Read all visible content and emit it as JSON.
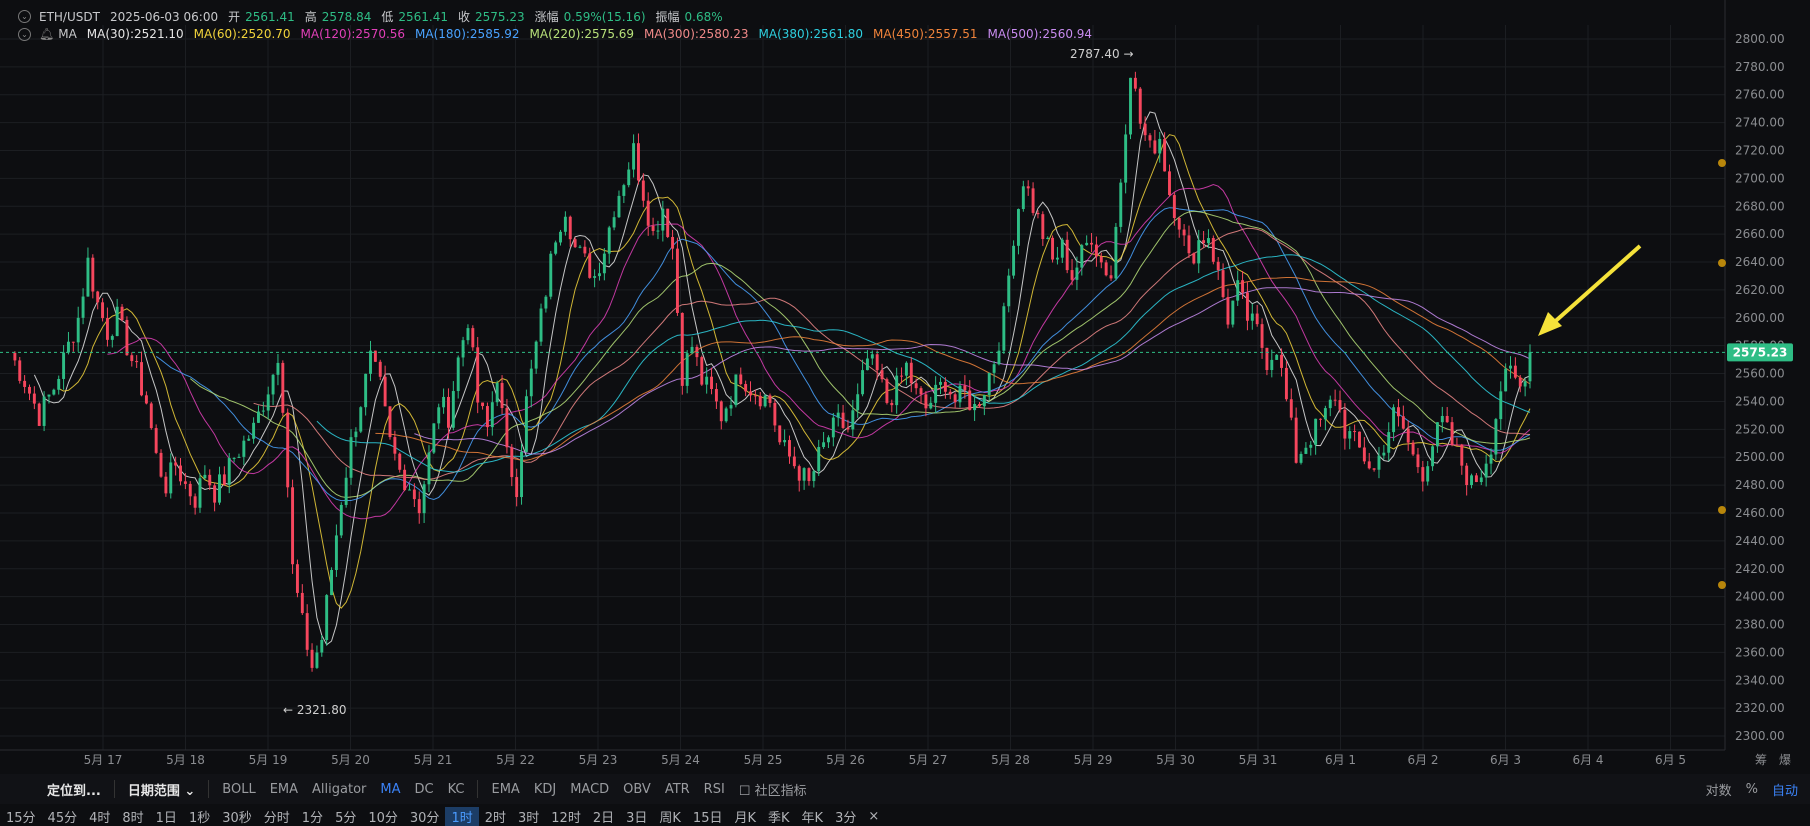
{
  "header": {
    "symbol": "ETH/USDT",
    "datetime": "2025-06-03 06:00",
    "open_label": "开",
    "open": "2561.41",
    "high_label": "高",
    "high": "2578.84",
    "low_label": "低",
    "low": "2561.41",
    "close_label": "收",
    "close": "2575.23",
    "change_label": "涨幅",
    "change": "0.59%(15.16)",
    "amp_label": "振幅",
    "amp": "0.68%"
  },
  "ma_row": {
    "name": "MA",
    "items": [
      {
        "label": "MA(30):2521.10",
        "color": "#e6e6e6"
      },
      {
        "label": "MA(60):2520.70",
        "color": "#f2d43c"
      },
      {
        "label": "MA(120):2570.56",
        "color": "#e040b8"
      },
      {
        "label": "MA(180):2585.92",
        "color": "#4aa3ff"
      },
      {
        "label": "MA(220):2575.69",
        "color": "#b7e07a"
      },
      {
        "label": "MA(300):2580.23",
        "color": "#f08a8a"
      },
      {
        "label": "MA(380):2561.80",
        "color": "#2fd0e0"
      },
      {
        "label": "MA(450):2557.51",
        "color": "#f0843c"
      },
      {
        "label": "MA(500):2560.94",
        "color": "#c88cf0"
      }
    ]
  },
  "chart_data": {
    "type": "candlestick",
    "ylim": [
      2290,
      2810
    ],
    "y_ticks": [
      "2800.00",
      "2780.00",
      "2760.00",
      "2740.00",
      "2720.00",
      "2700.00",
      "2680.00",
      "2660.00",
      "2640.00",
      "2620.00",
      "2600.00",
      "2580.00",
      "2560.00",
      "2540.00",
      "2520.00",
      "2500.00",
      "2480.00",
      "2460.00",
      "2440.00",
      "2420.00",
      "2400.00",
      "2380.00",
      "2360.00",
      "2340.00",
      "2320.00",
      "2300.00"
    ],
    "x_ticks": [
      "5月 17",
      "5月 18",
      "5月 19",
      "5月 20",
      "5月 21",
      "5月 22",
      "5月 23",
      "5月 24",
      "5月 25",
      "5月 26",
      "5月 27",
      "5月 28",
      "5月 29",
      "5月 30",
      "5月 31",
      "6月 1",
      "6月 2",
      "6月 3",
      "6月 4",
      "6月 5"
    ],
    "x_ticks_extra": [
      "筹",
      "爆"
    ],
    "last_price": "2575.23",
    "high_marker": "2787.40 →",
    "low_marker": "← 2321.80",
    "up_color": "#2ebd85",
    "down_color": "#f6465d",
    "close_path": [
      [
        0,
        2575
      ],
      [
        3,
        2555
      ],
      [
        6,
        2530
      ],
      [
        9,
        2550
      ],
      [
        12,
        2580
      ],
      [
        14,
        2600
      ],
      [
        16,
        2640
      ],
      [
        18,
        2610
      ],
      [
        20,
        2590
      ],
      [
        22,
        2600
      ],
      [
        24,
        2580
      ],
      [
        26,
        2560
      ],
      [
        28,
        2540
      ],
      [
        30,
        2500
      ],
      [
        32,
        2480
      ],
      [
        34,
        2495
      ],
      [
        36,
        2480
      ],
      [
        38,
        2470
      ],
      [
        40,
        2490
      ],
      [
        42,
        2475
      ],
      [
        44,
        2485
      ],
      [
        46,
        2500
      ],
      [
        48,
        2510
      ],
      [
        50,
        2520
      ],
      [
        52,
        2540
      ],
      [
        54,
        2560
      ],
      [
        55,
        2575
      ],
      [
        56,
        2540
      ],
      [
        58,
        2420
      ],
      [
        60,
        2380
      ],
      [
        62,
        2350
      ],
      [
        64,
        2370
      ],
      [
        66,
        2420
      ],
      [
        68,
        2470
      ],
      [
        70,
        2510
      ],
      [
        72,
        2540
      ],
      [
        74,
        2570
      ],
      [
        76,
        2550
      ],
      [
        78,
        2510
      ],
      [
        80,
        2490
      ],
      [
        82,
        2480
      ],
      [
        84,
        2465
      ],
      [
        86,
        2500
      ],
      [
        88,
        2540
      ],
      [
        90,
        2530
      ],
      [
        92,
        2570
      ],
      [
        94,
        2600
      ],
      [
        96,
        2540
      ],
      [
        98,
        2520
      ],
      [
        100,
        2560
      ],
      [
        102,
        2500
      ],
      [
        104,
        2480
      ],
      [
        106,
        2540
      ],
      [
        108,
        2580
      ],
      [
        110,
        2620
      ],
      [
        112,
        2660
      ],
      [
        114,
        2680
      ],
      [
        116,
        2650
      ],
      [
        118,
        2640
      ],
      [
        120,
        2630
      ],
      [
        122,
        2650
      ],
      [
        124,
        2680
      ],
      [
        126,
        2700
      ],
      [
        128,
        2720
      ],
      [
        130,
        2690
      ],
      [
        132,
        2660
      ],
      [
        134,
        2680
      ],
      [
        136,
        2650
      ],
      [
        138,
        2560
      ],
      [
        140,
        2580
      ],
      [
        142,
        2555
      ],
      [
        144,
        2545
      ],
      [
        146,
        2530
      ],
      [
        148,
        2545
      ],
      [
        150,
        2560
      ],
      [
        152,
        2550
      ],
      [
        154,
        2545
      ],
      [
        156,
        2540
      ],
      [
        158,
        2510
      ],
      [
        160,
        2500
      ],
      [
        162,
        2490
      ],
      [
        164,
        2480
      ],
      [
        166,
        2500
      ],
      [
        168,
        2515
      ],
      [
        170,
        2525
      ],
      [
        172,
        2520
      ],
      [
        174,
        2540
      ],
      [
        176,
        2570
      ],
      [
        178,
        2560
      ],
      [
        180,
        2540
      ],
      [
        182,
        2550
      ],
      [
        184,
        2565
      ],
      [
        186,
        2545
      ],
      [
        188,
        2535
      ],
      [
        190,
        2545
      ],
      [
        192,
        2555
      ],
      [
        194,
        2540
      ],
      [
        196,
        2545
      ],
      [
        198,
        2535
      ],
      [
        200,
        2550
      ],
      [
        202,
        2570
      ],
      [
        204,
        2600
      ],
      [
        206,
        2660
      ],
      [
        208,
        2700
      ],
      [
        210,
        2680
      ],
      [
        212,
        2660
      ],
      [
        214,
        2640
      ],
      [
        216,
        2650
      ],
      [
        218,
        2630
      ],
      [
        220,
        2645
      ],
      [
        222,
        2660
      ],
      [
        224,
        2640
      ],
      [
        226,
        2630
      ],
      [
        228,
        2700
      ],
      [
        230,
        2780
      ],
      [
        232,
        2740
      ],
      [
        234,
        2720
      ],
      [
        236,
        2730
      ],
      [
        238,
        2690
      ],
      [
        240,
        2670
      ],
      [
        242,
        2640
      ],
      [
        244,
        2655
      ],
      [
        246,
        2660
      ],
      [
        248,
        2630
      ],
      [
        250,
        2600
      ],
      [
        252,
        2620
      ],
      [
        254,
        2600
      ],
      [
        256,
        2590
      ],
      [
        258,
        2570
      ],
      [
        260,
        2580
      ],
      [
        262,
        2540
      ],
      [
        264,
        2500
      ],
      [
        266,
        2510
      ],
      [
        268,
        2520
      ],
      [
        270,
        2530
      ],
      [
        272,
        2545
      ],
      [
        274,
        2520
      ],
      [
        276,
        2510
      ],
      [
        278,
        2500
      ],
      [
        280,
        2490
      ],
      [
        282,
        2510
      ],
      [
        284,
        2530
      ],
      [
        286,
        2520
      ],
      [
        288,
        2500
      ],
      [
        290,
        2490
      ],
      [
        292,
        2510
      ],
      [
        294,
        2525
      ],
      [
        296,
        2510
      ],
      [
        298,
        2495
      ],
      [
        300,
        2480
      ],
      [
        302,
        2490
      ],
      [
        304,
        2510
      ],
      [
        306,
        2550
      ],
      [
        308,
        2560
      ],
      [
        310,
        2550
      ],
      [
        312,
        2575
      ]
    ]
  },
  "toolbar": {
    "badge": "析",
    "locate": "定位到...",
    "date_range": "日期范围",
    "main_indicators": [
      "BOLL",
      "EMA",
      "Alligator",
      "MA",
      "DC",
      "KC"
    ],
    "active_indicator": "MA",
    "sub_indicators": [
      "EMA",
      "KDJ",
      "MACD",
      "OBV",
      "ATR",
      "RSI"
    ],
    "community": "社区指标",
    "scale_log": "对数",
    "scale_pct": "%",
    "scale_auto": "自动"
  },
  "timeframes": [
    "15分",
    "45分",
    "4时",
    "8时",
    "1日",
    "1秒",
    "30秒",
    "分时",
    "1分",
    "5分",
    "10分",
    "30分",
    "1时",
    "2时",
    "3时",
    "12时",
    "2日",
    "3日",
    "周K",
    "15日",
    "月K",
    "季K",
    "年K",
    "3分"
  ],
  "active_timeframe": "1时",
  "close_icon": "×"
}
